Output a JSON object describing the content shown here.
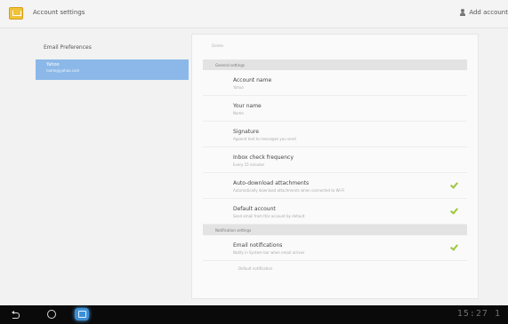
{
  "action_bar": {
    "title": "Account settings",
    "add_account_label": "Add account",
    "app_icon": "email-app-icon",
    "person_icon": "person-add-icon"
  },
  "left_panel": {
    "email_preferences": "Email Preferences",
    "account_name": "Yahoo",
    "account_email": "name@yahoo.com"
  },
  "settings": {
    "top_label": "Delete",
    "general_header": "General settings",
    "account_name": {
      "title": "Account name",
      "summary": "Yahoo"
    },
    "your_name": {
      "title": "Your name",
      "summary": "Name"
    },
    "signature": {
      "title": "Signature",
      "summary": "Append text to messages you send"
    },
    "inbox_check": {
      "title": "Inbox check frequency",
      "summary": "Every 15 minutes"
    },
    "auto_download": {
      "title": "Auto-download attachments",
      "summary": "Automatically download attachments when connected to Wi-Fi",
      "checked": true
    },
    "default_account": {
      "title": "Default account",
      "summary": "Send email from this account by default",
      "checked": true
    },
    "notification_header": "Notification settings",
    "email_notifications": {
      "title": "Email notifications",
      "summary": "Notify in System bar when email arrives",
      "checked": true
    },
    "default_notifications": "Default notification"
  },
  "nav_bar": {
    "back_icon": "back-icon",
    "home_icon": "home-icon",
    "recent_icon": "recent-apps-icon",
    "clock": "15:27 1"
  },
  "colors": {
    "accent": "#8bb8e8",
    "check": "#9ac73b",
    "nav_bar": "#0a0a0a"
  }
}
